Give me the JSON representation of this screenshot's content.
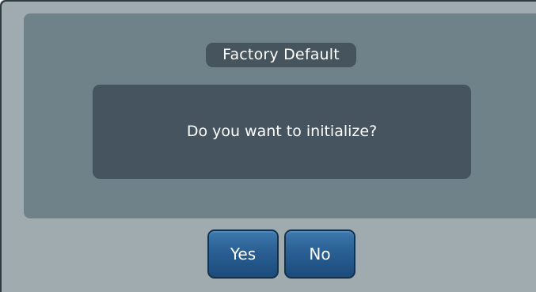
{
  "dialog": {
    "title": "Factory Default",
    "message": "Do you want to initialize?",
    "buttons": {
      "yes_label": "Yes",
      "no_label": "No"
    }
  },
  "colors": {
    "frame_bg": "#9fabaf",
    "panel_bg": "#6f8289",
    "title_bg": "#46545d",
    "message_bg": "#45545e",
    "button_bg": "#2a5f93",
    "text": "#ffffff"
  }
}
